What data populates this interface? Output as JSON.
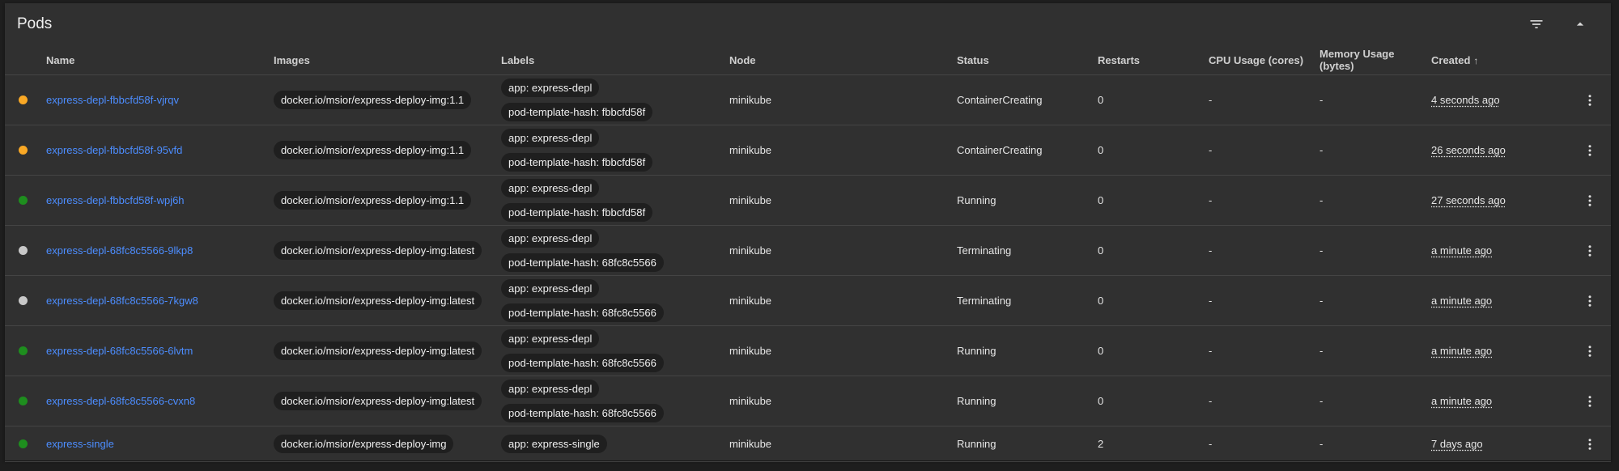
{
  "panel": {
    "title": "Pods"
  },
  "colors": {
    "pending": "#f9a825",
    "running": "#1e8e1e",
    "terminating": "#c8c8c8",
    "link": "#4c8dff"
  },
  "icons": {
    "filter": "filter-icon",
    "collapse": "chevron-up-icon",
    "menu": "more-vert-icon",
    "sort": "arrow-up-icon"
  },
  "columns": {
    "name": "Name",
    "images": "Images",
    "labels": "Labels",
    "node": "Node",
    "status": "Status",
    "restarts": "Restarts",
    "cpu": "CPU Usage (cores)",
    "memory": "Memory Usage (bytes)",
    "created": "Created",
    "created_sort": "↑"
  },
  "pods": [
    {
      "state": "pending",
      "name": "express-depl-fbbcfd58f-vjrqv",
      "image": "docker.io/msior/express-deploy-img:1.1",
      "labels": [
        "app: express-depl",
        "pod-template-hash: fbbcfd58f"
      ],
      "node": "minikube",
      "status": "ContainerCreating",
      "restarts": "0",
      "cpu": "-",
      "memory": "-",
      "created": "4 seconds ago"
    },
    {
      "state": "pending",
      "name": "express-depl-fbbcfd58f-95vfd",
      "image": "docker.io/msior/express-deploy-img:1.1",
      "labels": [
        "app: express-depl",
        "pod-template-hash: fbbcfd58f"
      ],
      "node": "minikube",
      "status": "ContainerCreating",
      "restarts": "0",
      "cpu": "-",
      "memory": "-",
      "created": "26 seconds ago"
    },
    {
      "state": "running",
      "name": "express-depl-fbbcfd58f-wpj6h",
      "image": "docker.io/msior/express-deploy-img:1.1",
      "labels": [
        "app: express-depl",
        "pod-template-hash: fbbcfd58f"
      ],
      "node": "minikube",
      "status": "Running",
      "restarts": "0",
      "cpu": "-",
      "memory": "-",
      "created": "27 seconds ago"
    },
    {
      "state": "terminating",
      "name": "express-depl-68fc8c5566-9lkp8",
      "image": "docker.io/msior/express-deploy-img:latest",
      "labels": [
        "app: express-depl",
        "pod-template-hash: 68fc8c5566"
      ],
      "node": "minikube",
      "status": "Terminating",
      "restarts": "0",
      "cpu": "-",
      "memory": "-",
      "created": "a minute ago"
    },
    {
      "state": "terminating",
      "name": "express-depl-68fc8c5566-7kgw8",
      "image": "docker.io/msior/express-deploy-img:latest",
      "labels": [
        "app: express-depl",
        "pod-template-hash: 68fc8c5566"
      ],
      "node": "minikube",
      "status": "Terminating",
      "restarts": "0",
      "cpu": "-",
      "memory": "-",
      "created": "a minute ago"
    },
    {
      "state": "running",
      "name": "express-depl-68fc8c5566-6lvtm",
      "image": "docker.io/msior/express-deploy-img:latest",
      "labels": [
        "app: express-depl",
        "pod-template-hash: 68fc8c5566"
      ],
      "node": "minikube",
      "status": "Running",
      "restarts": "0",
      "cpu": "-",
      "memory": "-",
      "created": "a minute ago"
    },
    {
      "state": "running",
      "name": "express-depl-68fc8c5566-cvxn8",
      "image": "docker.io/msior/express-deploy-img:latest",
      "labels": [
        "app: express-depl",
        "pod-template-hash: 68fc8c5566"
      ],
      "node": "minikube",
      "status": "Running",
      "restarts": "0",
      "cpu": "-",
      "memory": "-",
      "created": "a minute ago"
    },
    {
      "state": "running",
      "name": "express-single",
      "image": "docker.io/msior/express-deploy-img",
      "labels": [
        "app: express-single"
      ],
      "node": "minikube",
      "status": "Running",
      "restarts": "2",
      "cpu": "-",
      "memory": "-",
      "created": "7 days ago"
    }
  ]
}
